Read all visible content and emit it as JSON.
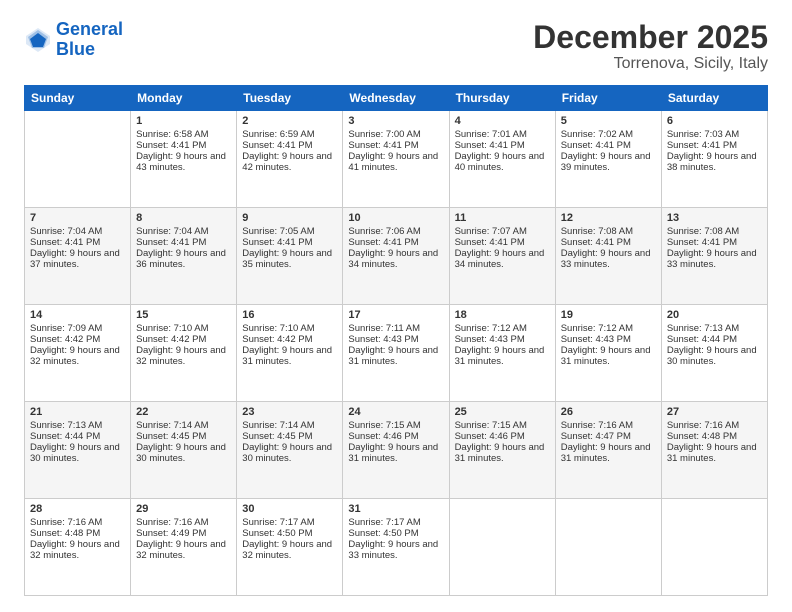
{
  "logo": {
    "line1": "General",
    "line2": "Blue"
  },
  "title": "December 2025",
  "location": "Torrenova, Sicily, Italy",
  "headers": [
    "Sunday",
    "Monday",
    "Tuesday",
    "Wednesday",
    "Thursday",
    "Friday",
    "Saturday"
  ],
  "weeks": [
    [
      {
        "day": "",
        "sunrise": "",
        "sunset": "",
        "daylight": ""
      },
      {
        "day": "1",
        "sunrise": "Sunrise: 6:58 AM",
        "sunset": "Sunset: 4:41 PM",
        "daylight": "Daylight: 9 hours and 43 minutes."
      },
      {
        "day": "2",
        "sunrise": "Sunrise: 6:59 AM",
        "sunset": "Sunset: 4:41 PM",
        "daylight": "Daylight: 9 hours and 42 minutes."
      },
      {
        "day": "3",
        "sunrise": "Sunrise: 7:00 AM",
        "sunset": "Sunset: 4:41 PM",
        "daylight": "Daylight: 9 hours and 41 minutes."
      },
      {
        "day": "4",
        "sunrise": "Sunrise: 7:01 AM",
        "sunset": "Sunset: 4:41 PM",
        "daylight": "Daylight: 9 hours and 40 minutes."
      },
      {
        "day": "5",
        "sunrise": "Sunrise: 7:02 AM",
        "sunset": "Sunset: 4:41 PM",
        "daylight": "Daylight: 9 hours and 39 minutes."
      },
      {
        "day": "6",
        "sunrise": "Sunrise: 7:03 AM",
        "sunset": "Sunset: 4:41 PM",
        "daylight": "Daylight: 9 hours and 38 minutes."
      }
    ],
    [
      {
        "day": "7",
        "sunrise": "Sunrise: 7:04 AM",
        "sunset": "Sunset: 4:41 PM",
        "daylight": "Daylight: 9 hours and 37 minutes."
      },
      {
        "day": "8",
        "sunrise": "Sunrise: 7:04 AM",
        "sunset": "Sunset: 4:41 PM",
        "daylight": "Daylight: 9 hours and 36 minutes."
      },
      {
        "day": "9",
        "sunrise": "Sunrise: 7:05 AM",
        "sunset": "Sunset: 4:41 PM",
        "daylight": "Daylight: 9 hours and 35 minutes."
      },
      {
        "day": "10",
        "sunrise": "Sunrise: 7:06 AM",
        "sunset": "Sunset: 4:41 PM",
        "daylight": "Daylight: 9 hours and 34 minutes."
      },
      {
        "day": "11",
        "sunrise": "Sunrise: 7:07 AM",
        "sunset": "Sunset: 4:41 PM",
        "daylight": "Daylight: 9 hours and 34 minutes."
      },
      {
        "day": "12",
        "sunrise": "Sunrise: 7:08 AM",
        "sunset": "Sunset: 4:41 PM",
        "daylight": "Daylight: 9 hours and 33 minutes."
      },
      {
        "day": "13",
        "sunrise": "Sunrise: 7:08 AM",
        "sunset": "Sunset: 4:41 PM",
        "daylight": "Daylight: 9 hours and 33 minutes."
      }
    ],
    [
      {
        "day": "14",
        "sunrise": "Sunrise: 7:09 AM",
        "sunset": "Sunset: 4:42 PM",
        "daylight": "Daylight: 9 hours and 32 minutes."
      },
      {
        "day": "15",
        "sunrise": "Sunrise: 7:10 AM",
        "sunset": "Sunset: 4:42 PM",
        "daylight": "Daylight: 9 hours and 32 minutes."
      },
      {
        "day": "16",
        "sunrise": "Sunrise: 7:10 AM",
        "sunset": "Sunset: 4:42 PM",
        "daylight": "Daylight: 9 hours and 31 minutes."
      },
      {
        "day": "17",
        "sunrise": "Sunrise: 7:11 AM",
        "sunset": "Sunset: 4:43 PM",
        "daylight": "Daylight: 9 hours and 31 minutes."
      },
      {
        "day": "18",
        "sunrise": "Sunrise: 7:12 AM",
        "sunset": "Sunset: 4:43 PM",
        "daylight": "Daylight: 9 hours and 31 minutes."
      },
      {
        "day": "19",
        "sunrise": "Sunrise: 7:12 AM",
        "sunset": "Sunset: 4:43 PM",
        "daylight": "Daylight: 9 hours and 31 minutes."
      },
      {
        "day": "20",
        "sunrise": "Sunrise: 7:13 AM",
        "sunset": "Sunset: 4:44 PM",
        "daylight": "Daylight: 9 hours and 30 minutes."
      }
    ],
    [
      {
        "day": "21",
        "sunrise": "Sunrise: 7:13 AM",
        "sunset": "Sunset: 4:44 PM",
        "daylight": "Daylight: 9 hours and 30 minutes."
      },
      {
        "day": "22",
        "sunrise": "Sunrise: 7:14 AM",
        "sunset": "Sunset: 4:45 PM",
        "daylight": "Daylight: 9 hours and 30 minutes."
      },
      {
        "day": "23",
        "sunrise": "Sunrise: 7:14 AM",
        "sunset": "Sunset: 4:45 PM",
        "daylight": "Daylight: 9 hours and 30 minutes."
      },
      {
        "day": "24",
        "sunrise": "Sunrise: 7:15 AM",
        "sunset": "Sunset: 4:46 PM",
        "daylight": "Daylight: 9 hours and 31 minutes."
      },
      {
        "day": "25",
        "sunrise": "Sunrise: 7:15 AM",
        "sunset": "Sunset: 4:46 PM",
        "daylight": "Daylight: 9 hours and 31 minutes."
      },
      {
        "day": "26",
        "sunrise": "Sunrise: 7:16 AM",
        "sunset": "Sunset: 4:47 PM",
        "daylight": "Daylight: 9 hours and 31 minutes."
      },
      {
        "day": "27",
        "sunrise": "Sunrise: 7:16 AM",
        "sunset": "Sunset: 4:48 PM",
        "daylight": "Daylight: 9 hours and 31 minutes."
      }
    ],
    [
      {
        "day": "28",
        "sunrise": "Sunrise: 7:16 AM",
        "sunset": "Sunset: 4:48 PM",
        "daylight": "Daylight: 9 hours and 32 minutes."
      },
      {
        "day": "29",
        "sunrise": "Sunrise: 7:16 AM",
        "sunset": "Sunset: 4:49 PM",
        "daylight": "Daylight: 9 hours and 32 minutes."
      },
      {
        "day": "30",
        "sunrise": "Sunrise: 7:17 AM",
        "sunset": "Sunset: 4:50 PM",
        "daylight": "Daylight: 9 hours and 32 minutes."
      },
      {
        "day": "31",
        "sunrise": "Sunrise: 7:17 AM",
        "sunset": "Sunset: 4:50 PM",
        "daylight": "Daylight: 9 hours and 33 minutes."
      },
      {
        "day": "",
        "sunrise": "",
        "sunset": "",
        "daylight": ""
      },
      {
        "day": "",
        "sunrise": "",
        "sunset": "",
        "daylight": ""
      },
      {
        "day": "",
        "sunrise": "",
        "sunset": "",
        "daylight": ""
      }
    ]
  ]
}
